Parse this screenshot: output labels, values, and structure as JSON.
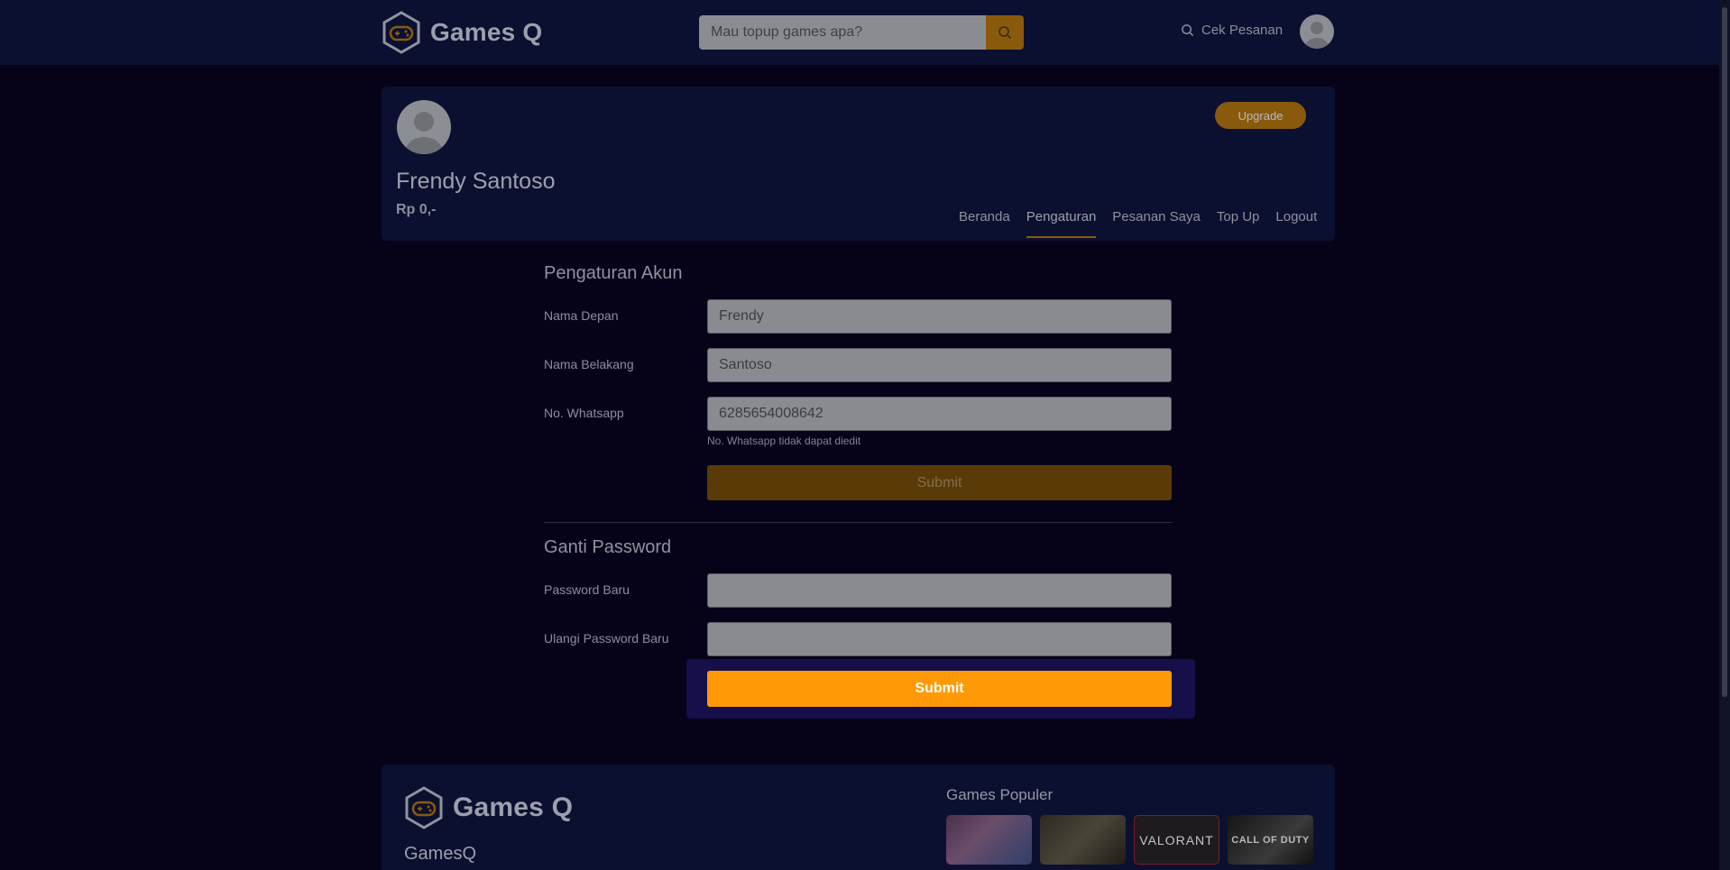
{
  "header": {
    "brand": "Games Q",
    "search_placeholder": "Mau topup games apa?",
    "cek_pesanan": "Cek Pesanan"
  },
  "profile": {
    "name": "Frendy Santoso",
    "balance": "Rp 0,-",
    "upgrade_label": "Upgrade",
    "tabs": [
      {
        "label": "Beranda",
        "active": false
      },
      {
        "label": "Pengaturan",
        "active": true
      },
      {
        "label": "Pesanan Saya",
        "active": false
      },
      {
        "label": "Top Up",
        "active": false
      },
      {
        "label": "Logout",
        "active": false
      }
    ]
  },
  "account_settings": {
    "title": "Pengaturan Akun",
    "first_name_label": "Nama Depan",
    "first_name_value": "Frendy",
    "last_name_label": "Nama Belakang",
    "last_name_value": "Santoso",
    "whatsapp_label": "No. Whatsapp",
    "whatsapp_value": "6285654008642",
    "whatsapp_hint": "No. Whatsapp tidak dapat diedit",
    "submit_label": "Submit"
  },
  "change_password": {
    "title": "Ganti Password",
    "new_password_label": "Password Baru",
    "new_password_value": "",
    "repeat_password_label": "Ulangi Password Baru",
    "repeat_password_value": "",
    "submit_label": "Submit"
  },
  "footer": {
    "brand": "Games Q",
    "company": "GamesQ",
    "popular_title": "Games Populer",
    "games": [
      "",
      "",
      "VALORANT",
      "CALL OF DUTY"
    ]
  },
  "colors": {
    "accent": "#ff9a06",
    "accent_dimmed": "#8a5a0c",
    "background": "#060318",
    "panel": "#0b1030"
  }
}
